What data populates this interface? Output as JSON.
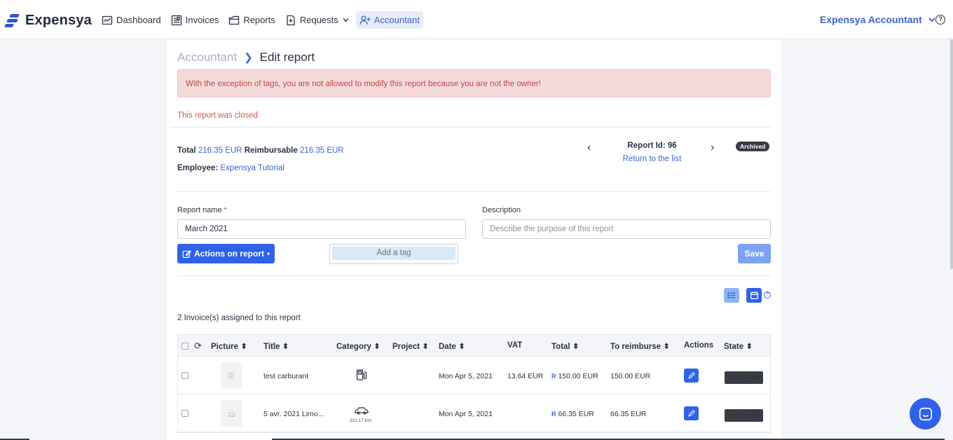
{
  "app": {
    "name": "Expensya",
    "brand_color": "#2f62e8"
  },
  "nav": {
    "items": [
      {
        "label": "Dashboard",
        "icon": "chart-icon"
      },
      {
        "label": "Invoices",
        "icon": "receipt-icon"
      },
      {
        "label": "Reports",
        "icon": "folder-icon"
      },
      {
        "label": "Requests",
        "icon": "file-plus-icon",
        "has_dropdown": true
      },
      {
        "label": "Accountant",
        "icon": "user-plus-icon",
        "active": true
      }
    ],
    "user_name": "Expensya Accountant"
  },
  "breadcrumb": {
    "parent": "Accountant",
    "current": "Edit report"
  },
  "alert": {
    "text": "With the exception of tags, you are not allowed to modify this report because you are not the owner!"
  },
  "closed_note": "This report was closed",
  "summary": {
    "total_label": "Total",
    "total_value": "216.35 EUR",
    "reimbursable_label": "Reimbursable",
    "reimbursable_value": "216.35 EUR",
    "employee_label": "Employee:",
    "employee_value": "Expensya Tutorial"
  },
  "report_nav": {
    "id_text": "Report Id: 96",
    "return_link": "Return to the list",
    "status": "Archived"
  },
  "form": {
    "report_name_label": "Report name",
    "required_mark": "*",
    "report_name_value": "March 2021",
    "description_label": "Description",
    "description_placeholder": "Describe the purpose of this report",
    "actions_button": "Actions on report",
    "tag_placeholder": "Add a tag",
    "save_button": "Save"
  },
  "invoices": {
    "count_text": "2 Invoice(s) assigned to this report",
    "columns": [
      "Picture",
      "Title",
      "Category",
      "Project",
      "Date",
      "VAT",
      "Total",
      "To reimburse",
      "Actions",
      "State"
    ],
    "reimbursable_mark": "R",
    "rows": [
      {
        "title": "test carburant",
        "category_icon": "fuel-pump-icon",
        "category_extra": "",
        "project": "",
        "date": "Mon Apr 5, 2021",
        "vat": "13.64 EUR",
        "total": "150.00 EUR",
        "to_reimburse": "150.00 EUR",
        "state": "Archived"
      },
      {
        "title": "5 avr. 2021 Limo...",
        "category_icon": "car-icon",
        "category_extra": "221.17 Km",
        "project": "",
        "date": "Mon Apr 5, 2021",
        "vat": "",
        "total": "66.35 EUR",
        "to_reimburse": "66.35 EUR",
        "state": "Archived"
      }
    ]
  }
}
